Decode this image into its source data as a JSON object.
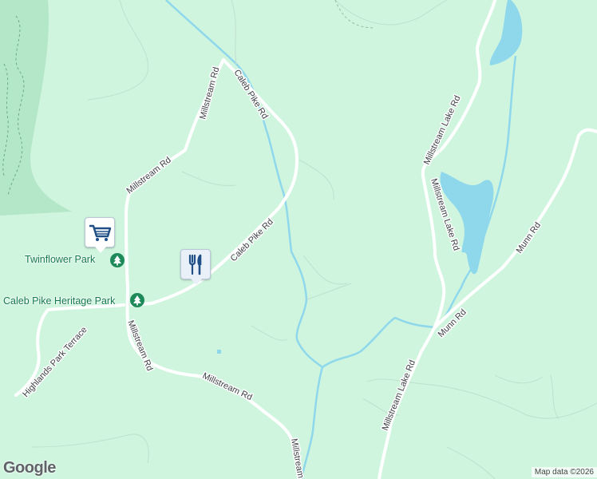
{
  "map": {
    "colors": {
      "land": "#cff5df",
      "forest": "#b4e6c8",
      "water": "#8fd8ec",
      "road": "#ffffff",
      "park_text": "#137a4d",
      "road_text": "#3b3f44"
    },
    "roads": {
      "caleb_pike_north": "Caleb Pike Rd",
      "caleb_pike_south": "Caleb Pike Rd",
      "millstream_north": "Millstream Rd",
      "millstream_west": "Millstream Rd",
      "millstream_mid": "Millstream Rd",
      "millstream_south": "Millstream Rd",
      "millstream_bottom": "Millstream",
      "millstream_lake_north": "Millstream Lake Rd",
      "millstream_lake_mid": "Millstream Lake Rd",
      "millstream_lake_south": "Millstream Lake Rd",
      "munn_north": "Munn Rd",
      "munn_south": "Munn Rd",
      "highlands_park": "Highlands Park Terrace"
    },
    "parks": [
      {
        "name": "Twinflower Park",
        "icon": "tree-icon"
      },
      {
        "name": "Caleb Pike Heritage Park",
        "icon": "tree-icon"
      }
    ],
    "pois": [
      {
        "kind": "shopping",
        "icon": "shopping-cart-icon"
      },
      {
        "kind": "restaurant",
        "icon": "fork-knife-icon"
      }
    ],
    "logo": "Google",
    "attribution": "Map data ©2026"
  }
}
